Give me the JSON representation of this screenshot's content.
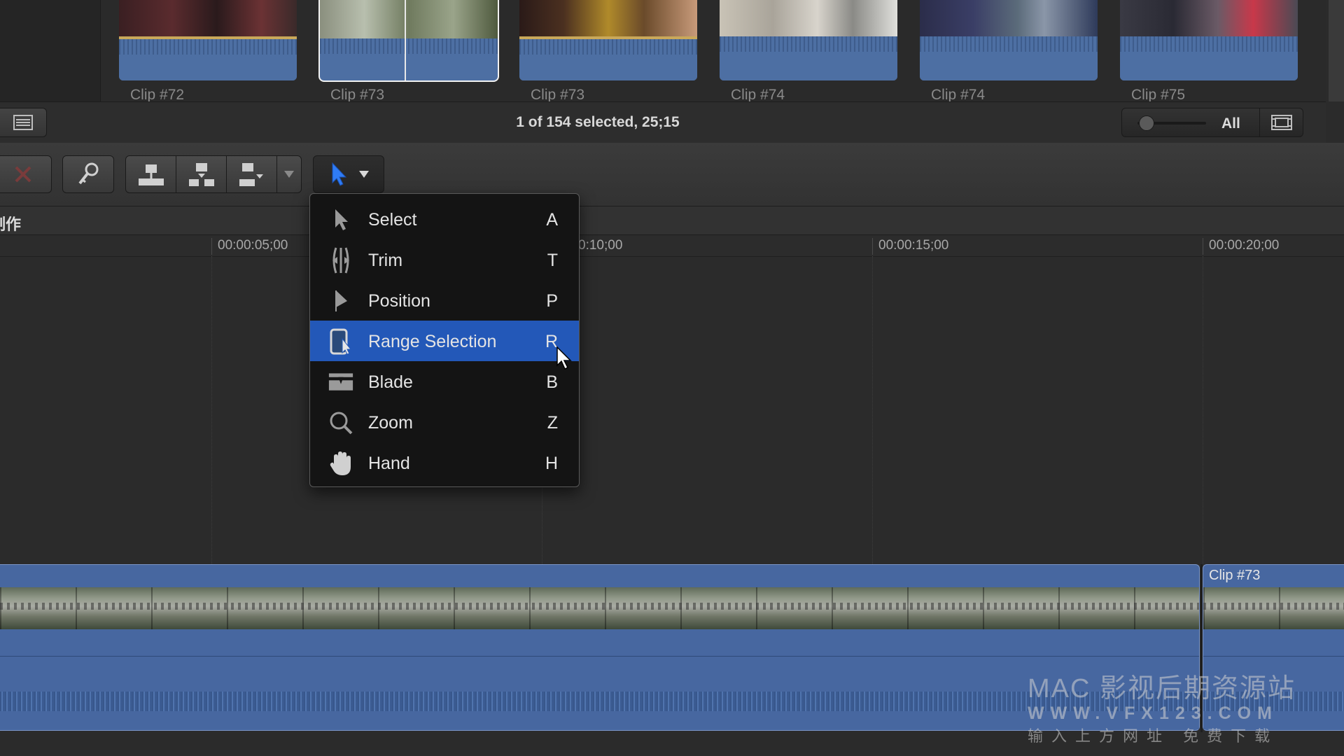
{
  "browser": {
    "clips": [
      {
        "label": "Clip #72",
        "selected": false
      },
      {
        "label": "Clip #73",
        "selected": true
      },
      {
        "label": "Clip #73",
        "selected": false
      },
      {
        "label": "Clip #74",
        "selected": false
      },
      {
        "label": "Clip #74",
        "selected": false
      },
      {
        "label": "Clip #75",
        "selected": false
      }
    ],
    "status_text": "1 of 154 selected, 25;15",
    "filter_label": "All"
  },
  "toolbar": {
    "icons": [
      "list-view-icon",
      "reject-icon",
      "keyword-icon",
      "connect-icon",
      "insert-icon",
      "append-icon",
      "edit-options-chevron-icon",
      "select-tool-icon",
      "tool-menu-chevron-icon"
    ]
  },
  "timeline": {
    "project_title": "制作",
    "ruler": [
      "00:00:05;00",
      "0:10;00",
      "00:00:15;00",
      "00:00:20;00"
    ],
    "clips": [
      {
        "label": ""
      },
      {
        "label": "Clip #73"
      }
    ]
  },
  "tool_menu": {
    "items": [
      {
        "label": "Select",
        "shortcut": "A",
        "icon": "arrow-icon",
        "highlighted": false
      },
      {
        "label": "Trim",
        "shortcut": "T",
        "icon": "trim-icon",
        "highlighted": false
      },
      {
        "label": "Position",
        "shortcut": "P",
        "icon": "position-icon",
        "highlighted": false
      },
      {
        "label": "Range Selection",
        "shortcut": "R",
        "icon": "range-selection-icon",
        "highlighted": true
      },
      {
        "label": "Blade",
        "shortcut": "B",
        "icon": "blade-icon",
        "highlighted": false
      },
      {
        "label": "Zoom",
        "shortcut": "Z",
        "icon": "magnifier-icon",
        "highlighted": false
      },
      {
        "label": "Hand",
        "shortcut": "H",
        "icon": "hand-icon",
        "highlighted": false
      }
    ]
  },
  "watermark": {
    "line1": "MAC 影视后期资源站",
    "line2": "WWW.VFX123.COM",
    "line3": "输入上方网址 免费下载"
  },
  "colors": {
    "accent": "#2358b8",
    "clip_blue": "#4767a0",
    "audio_band": "#c9a85a"
  }
}
